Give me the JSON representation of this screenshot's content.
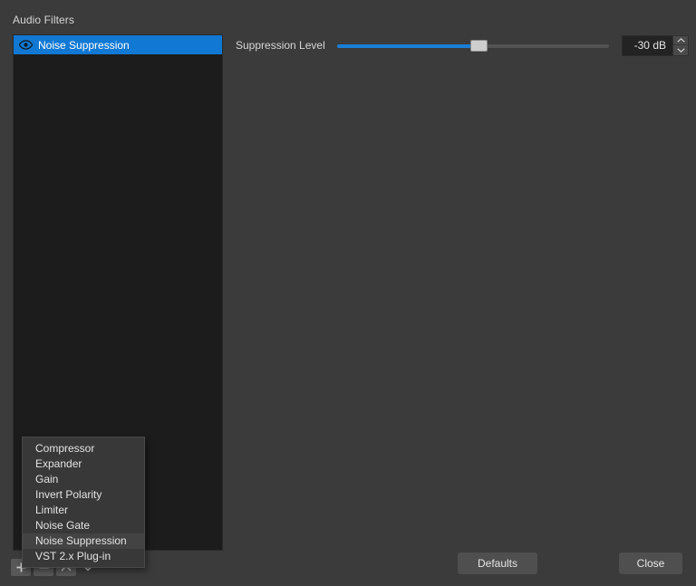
{
  "window": {
    "background_color": "#3b3b3b",
    "accent_color": "#1178d4"
  },
  "filters_section": {
    "label": "Audio Filters",
    "list_panel": {
      "background_color": "#1c1c1c",
      "items": [
        {
          "name": "Noise Suppression",
          "visible_icon": "eye-icon",
          "selected": true
        }
      ]
    },
    "toolbar": {
      "add_label": "+",
      "remove_label": "−",
      "gear_icon": "gear-icon",
      "chevron_icon": "chevron-down-icon"
    }
  },
  "popup_menu": {
    "visible": true,
    "highlighted": "Noise Suppression",
    "items": [
      "Compressor",
      "Expander",
      "Gain",
      "Invert Polarity",
      "Limiter",
      "Noise Gate",
      "Noise Suppression",
      "VST 2.x Plug-in"
    ]
  },
  "properties": {
    "rows": [
      {
        "label": "Suppression Level",
        "control": "slider",
        "value": "-30 dB",
        "value_number": -30,
        "min": -60,
        "max": 0,
        "fill_percent": 52.0
      }
    ]
  },
  "dialog_buttons": {
    "defaults_label": "Defaults",
    "close_label": "Close"
  }
}
